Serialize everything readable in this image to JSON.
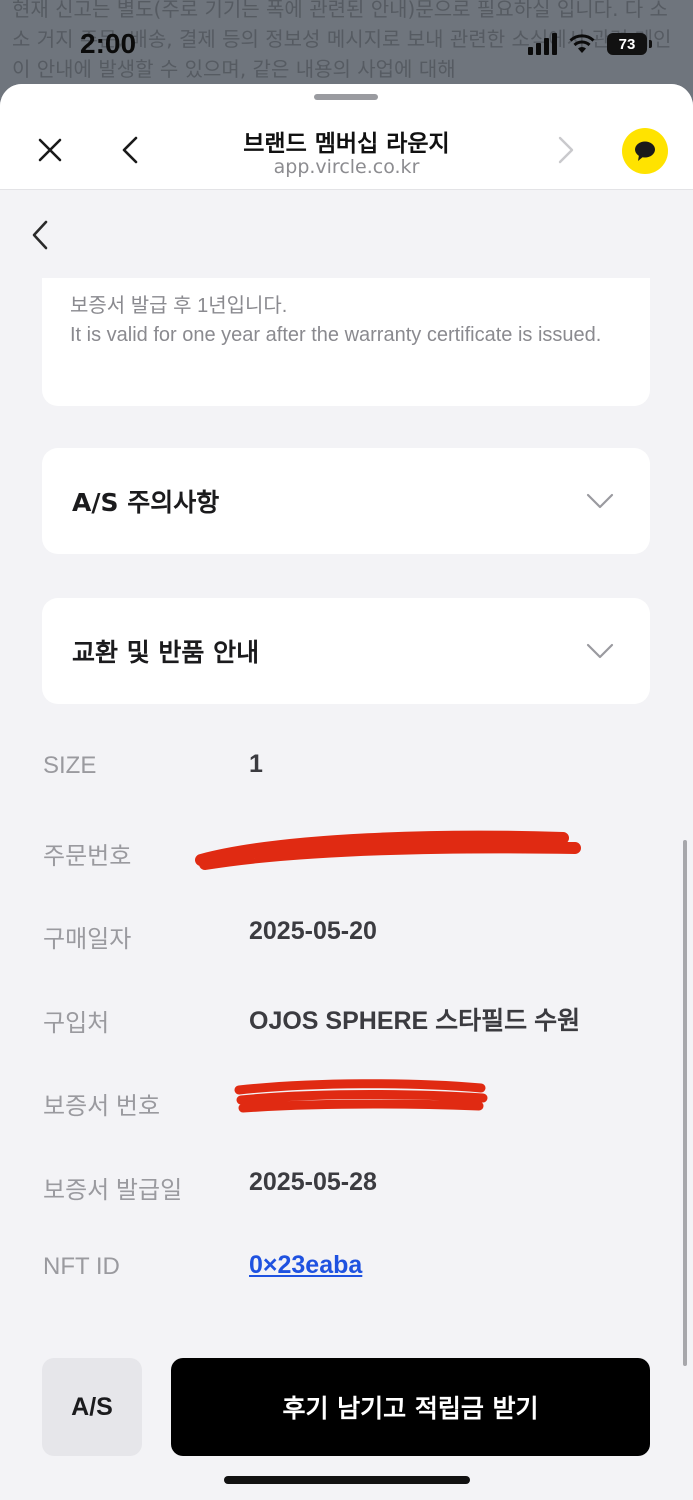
{
  "status": {
    "time": "2:00",
    "battery": "73",
    "bg_text": "현재 신고는 별도(주로 기기는 폭에 관련된 안내)문으로 필요하실 입니다. 다 소소 거지 주문, 배송, 결제 등의 정보성 메시지로 보내 관련한 소식에서 관련 메인이 안내에 발생할 수 있으며, 같은 내용의 사업에 대해"
  },
  "header": {
    "title": "브랜드 멤버십 라운지",
    "url": "app.vircle.co.kr",
    "close_icon": "close-icon",
    "back_icon": "chevron-left-icon",
    "forward_icon": "chevron-right-icon",
    "chat_icon": "chat-bubble-icon"
  },
  "warranty_note": {
    "line1": "보증서 발급 후 1년입니다.",
    "line2": "It is valid for one year after the warranty certificate is issued."
  },
  "accordions": [
    {
      "label": "A/S 주의사항",
      "icon": "chevron-down-icon"
    },
    {
      "label": "교환 및 반품 안내",
      "icon": "chevron-down-icon"
    }
  ],
  "details": [
    {
      "label": "SIZE",
      "value": "1"
    },
    {
      "label": "주문번호",
      "value": ""
    },
    {
      "label": "구매일자",
      "value": "2025-05-20"
    },
    {
      "label": "구입처",
      "value": "OJOS SPHERE 스타필드 수원"
    },
    {
      "label": "보증서 번호",
      "value": ""
    },
    {
      "label": "보증서 발급일",
      "value": "2025-05-28"
    },
    {
      "label": "NFT ID",
      "value": "0×23eaba"
    }
  ],
  "buttons": {
    "as": "A/S",
    "review": "후기 남기고 적립금 받기"
  },
  "colors": {
    "kakao_yellow": "#ffe300",
    "link_blue": "#1f52e0",
    "redaction_red": "#e02a12",
    "button_black": "#000000"
  }
}
